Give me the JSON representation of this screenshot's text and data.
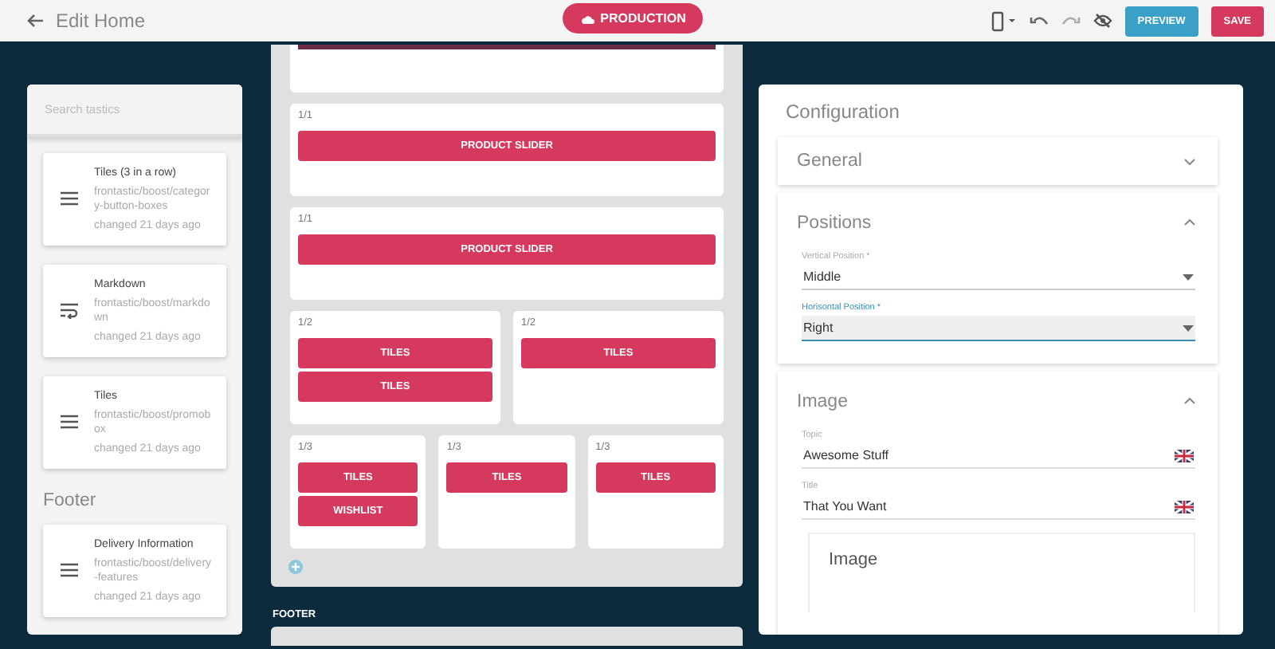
{
  "header": {
    "title": "Edit Home",
    "environment": "PRODUCTION",
    "buttons": [
      {
        "kind": "preview",
        "label": "PREVIEW"
      },
      {
        "kind": "save",
        "label": "SAVE"
      }
    ]
  },
  "sidebar": {
    "search": {
      "placeholder": "Search tastics"
    },
    "groups": [
      {
        "items": [
          {
            "kind": "list",
            "name": "Tiles (3 in a row)",
            "path": "frontastic/boost/category-button-boxes",
            "changed": "changed 21 days ago"
          },
          {
            "kind": "wrap",
            "name": "Markdown",
            "path": "frontastic/boost/markdown",
            "changed": "changed 21 days ago"
          },
          {
            "kind": "list",
            "name": "Tiles",
            "path": "frontastic/boost/promobox",
            "changed": "changed 21 days ago"
          }
        ]
      },
      {
        "title": "Footer",
        "items": [
          {
            "kind": "list",
            "name": "Delivery Information",
            "path": "frontastic/boost/delivery-features",
            "changed": "changed 21 days ago"
          }
        ]
      }
    ]
  },
  "canvas": {
    "layout_blocks": [
      {
        "columns": [
          {
            "width": "1/1",
            "tastics": [
              "PRODUCT SLIDER"
            ]
          }
        ]
      },
      {
        "columns": [
          {
            "width": "1/1",
            "tastics": [
              "PRODUCT SLIDER"
            ]
          }
        ]
      },
      {
        "columns": [
          {
            "width": "1/2",
            "tastics": [
              "TILES",
              "TILES"
            ]
          },
          {
            "width": "1/2",
            "tastics": [
              "TILES"
            ]
          }
        ]
      },
      {
        "columns": [
          {
            "width": "1/3",
            "tastics": [
              "TILES",
              "WISHLIST"
            ]
          },
          {
            "width": "1/3",
            "tastics": [
              "TILES"
            ]
          },
          {
            "width": "1/3",
            "tastics": [
              "TILES"
            ]
          }
        ]
      }
    ],
    "footer_label": "FOOTER"
  },
  "configuration": {
    "title": "Configuration",
    "sections": [
      {
        "title": "General",
        "expanded": false
      },
      {
        "title": "Positions",
        "expanded": true,
        "fields": [
          {
            "kind": "select",
            "label": "Vertical Position *",
            "value": "Middle",
            "focused": false
          },
          {
            "kind": "select",
            "label": "Horisontal Position *",
            "value": "Right",
            "focused": true
          }
        ]
      },
      {
        "title": "Image",
        "expanded": true,
        "fields": [
          {
            "kind": "text",
            "label": "Topic",
            "value": "Awesome Stuff",
            "focused": false
          },
          {
            "kind": "text",
            "label": "Title",
            "value": "That You Want",
            "focused": false
          },
          {
            "kind": "image",
            "label": "Image"
          }
        ]
      }
    ]
  }
}
